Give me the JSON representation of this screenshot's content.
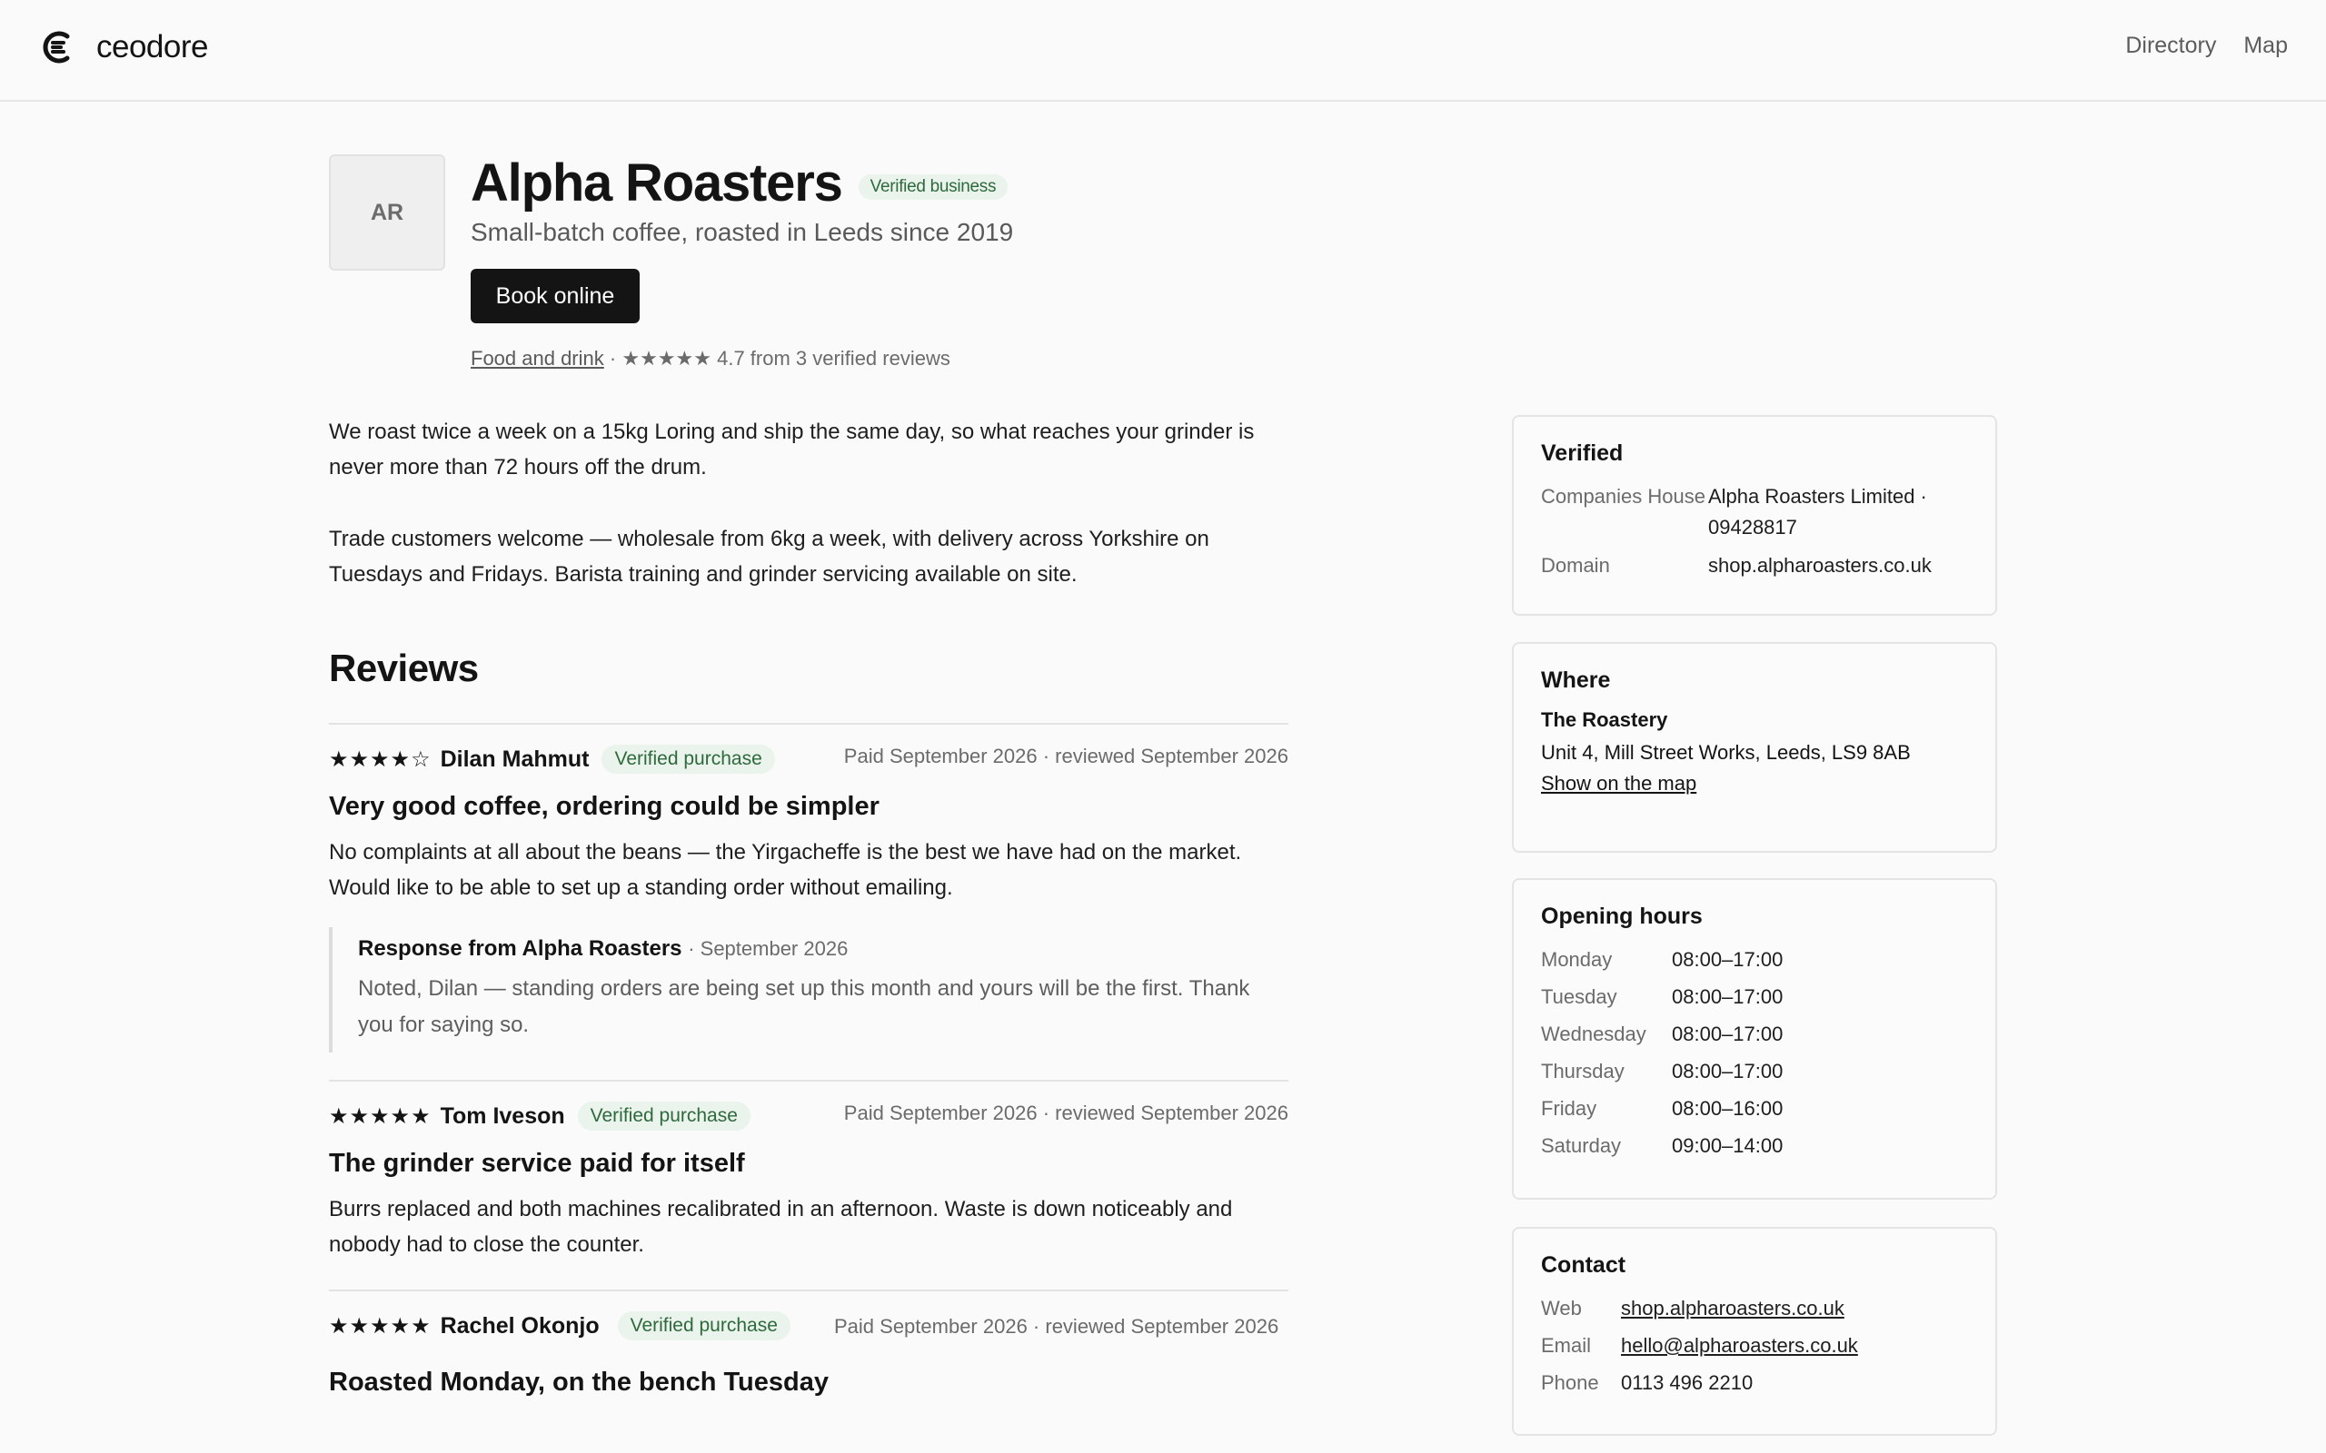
{
  "brand": {
    "name": "ceodore"
  },
  "nav": [
    {
      "label": "Directory"
    },
    {
      "label": "Map"
    }
  ],
  "business": {
    "initials": "AR",
    "name": "Alpha Roasters",
    "verified_badge": "Verified business",
    "tagline": "Small-batch coffee, roasted in Leeds since 2019",
    "book_button": "Book online",
    "category": "Food and drink",
    "rating_stars": "★★★★★",
    "rating_text": "4.7 from 3 verified reviews",
    "description": [
      "We roast twice a week on a 15kg Loring and ship the same day, so what reaches your grinder is never more than 72 hours off the drum.",
      "Trade customers welcome — wholesale from 6kg a week, with delivery across Yorkshire on Tuesdays and Fridays. Barista training and grinder servicing available on site."
    ]
  },
  "reviews": {
    "heading": "Reviews",
    "items": [
      {
        "stars": "★★★★☆",
        "rating": 4,
        "author": "Dilan Mahmut",
        "badge": "Verified purchase",
        "date": "Paid September 2026 · reviewed September 2026",
        "title": "Very good coffee, ordering could be simpler",
        "body": "No complaints at all about the beans — the Yirgacheffe is the best we have had on the market. Would like to be able to set up a standing order without emailing.",
        "response": {
          "from": "Response from Alpha Roasters",
          "date": "· September 2026",
          "body": "Noted, Dilan — standing orders are being set up this month and yours will be the first. Thank you for saying so."
        }
      },
      {
        "stars": "★★★★★",
        "rating": 5,
        "author": "Tom Iveson",
        "badge": "Verified purchase",
        "date": "Paid September 2026 · reviewed September 2026",
        "title": "The grinder service paid for itself",
        "body": "Burrs replaced and both machines recalibrated in an afternoon. Waste is down noticeably and nobody had to close the counter."
      },
      {
        "stars": "★★★★★",
        "rating": 5,
        "author": "Rachel Okonjo",
        "badge": "Verified purchase",
        "date": "Paid September 2026 · reviewed September 2026",
        "title": "Roasted Monday, on the bench Tuesday"
      }
    ]
  },
  "sidebar": {
    "verified": {
      "title": "Verified",
      "rows": [
        {
          "key": "Companies House",
          "value": "Alpha Roasters Limited · 09428817"
        },
        {
          "key": "Domain",
          "value": "shop.alpharoasters.co.uk"
        }
      ]
    },
    "where": {
      "title": "Where",
      "place": "The Roastery",
      "address": "Unit 4, Mill Street Works, Leeds, LS9 8AB",
      "map_link": "Show on the map"
    },
    "hours": {
      "title": "Opening hours",
      "rows": [
        {
          "day": "Monday",
          "time": "08:00–17:00"
        },
        {
          "day": "Tuesday",
          "time": "08:00–17:00"
        },
        {
          "day": "Wednesday",
          "time": "08:00–17:00"
        },
        {
          "day": "Thursday",
          "time": "08:00–17:00"
        },
        {
          "day": "Friday",
          "time": "08:00–16:00"
        },
        {
          "day": "Saturday",
          "time": "09:00–14:00"
        }
      ]
    },
    "contact": {
      "title": "Contact",
      "web_label": "Web",
      "web": "shop.alpharoasters.co.uk",
      "email_label": "Email",
      "email": "hello@alpharoasters.co.uk",
      "phone_label": "Phone",
      "phone": "0113 496 2210"
    }
  }
}
